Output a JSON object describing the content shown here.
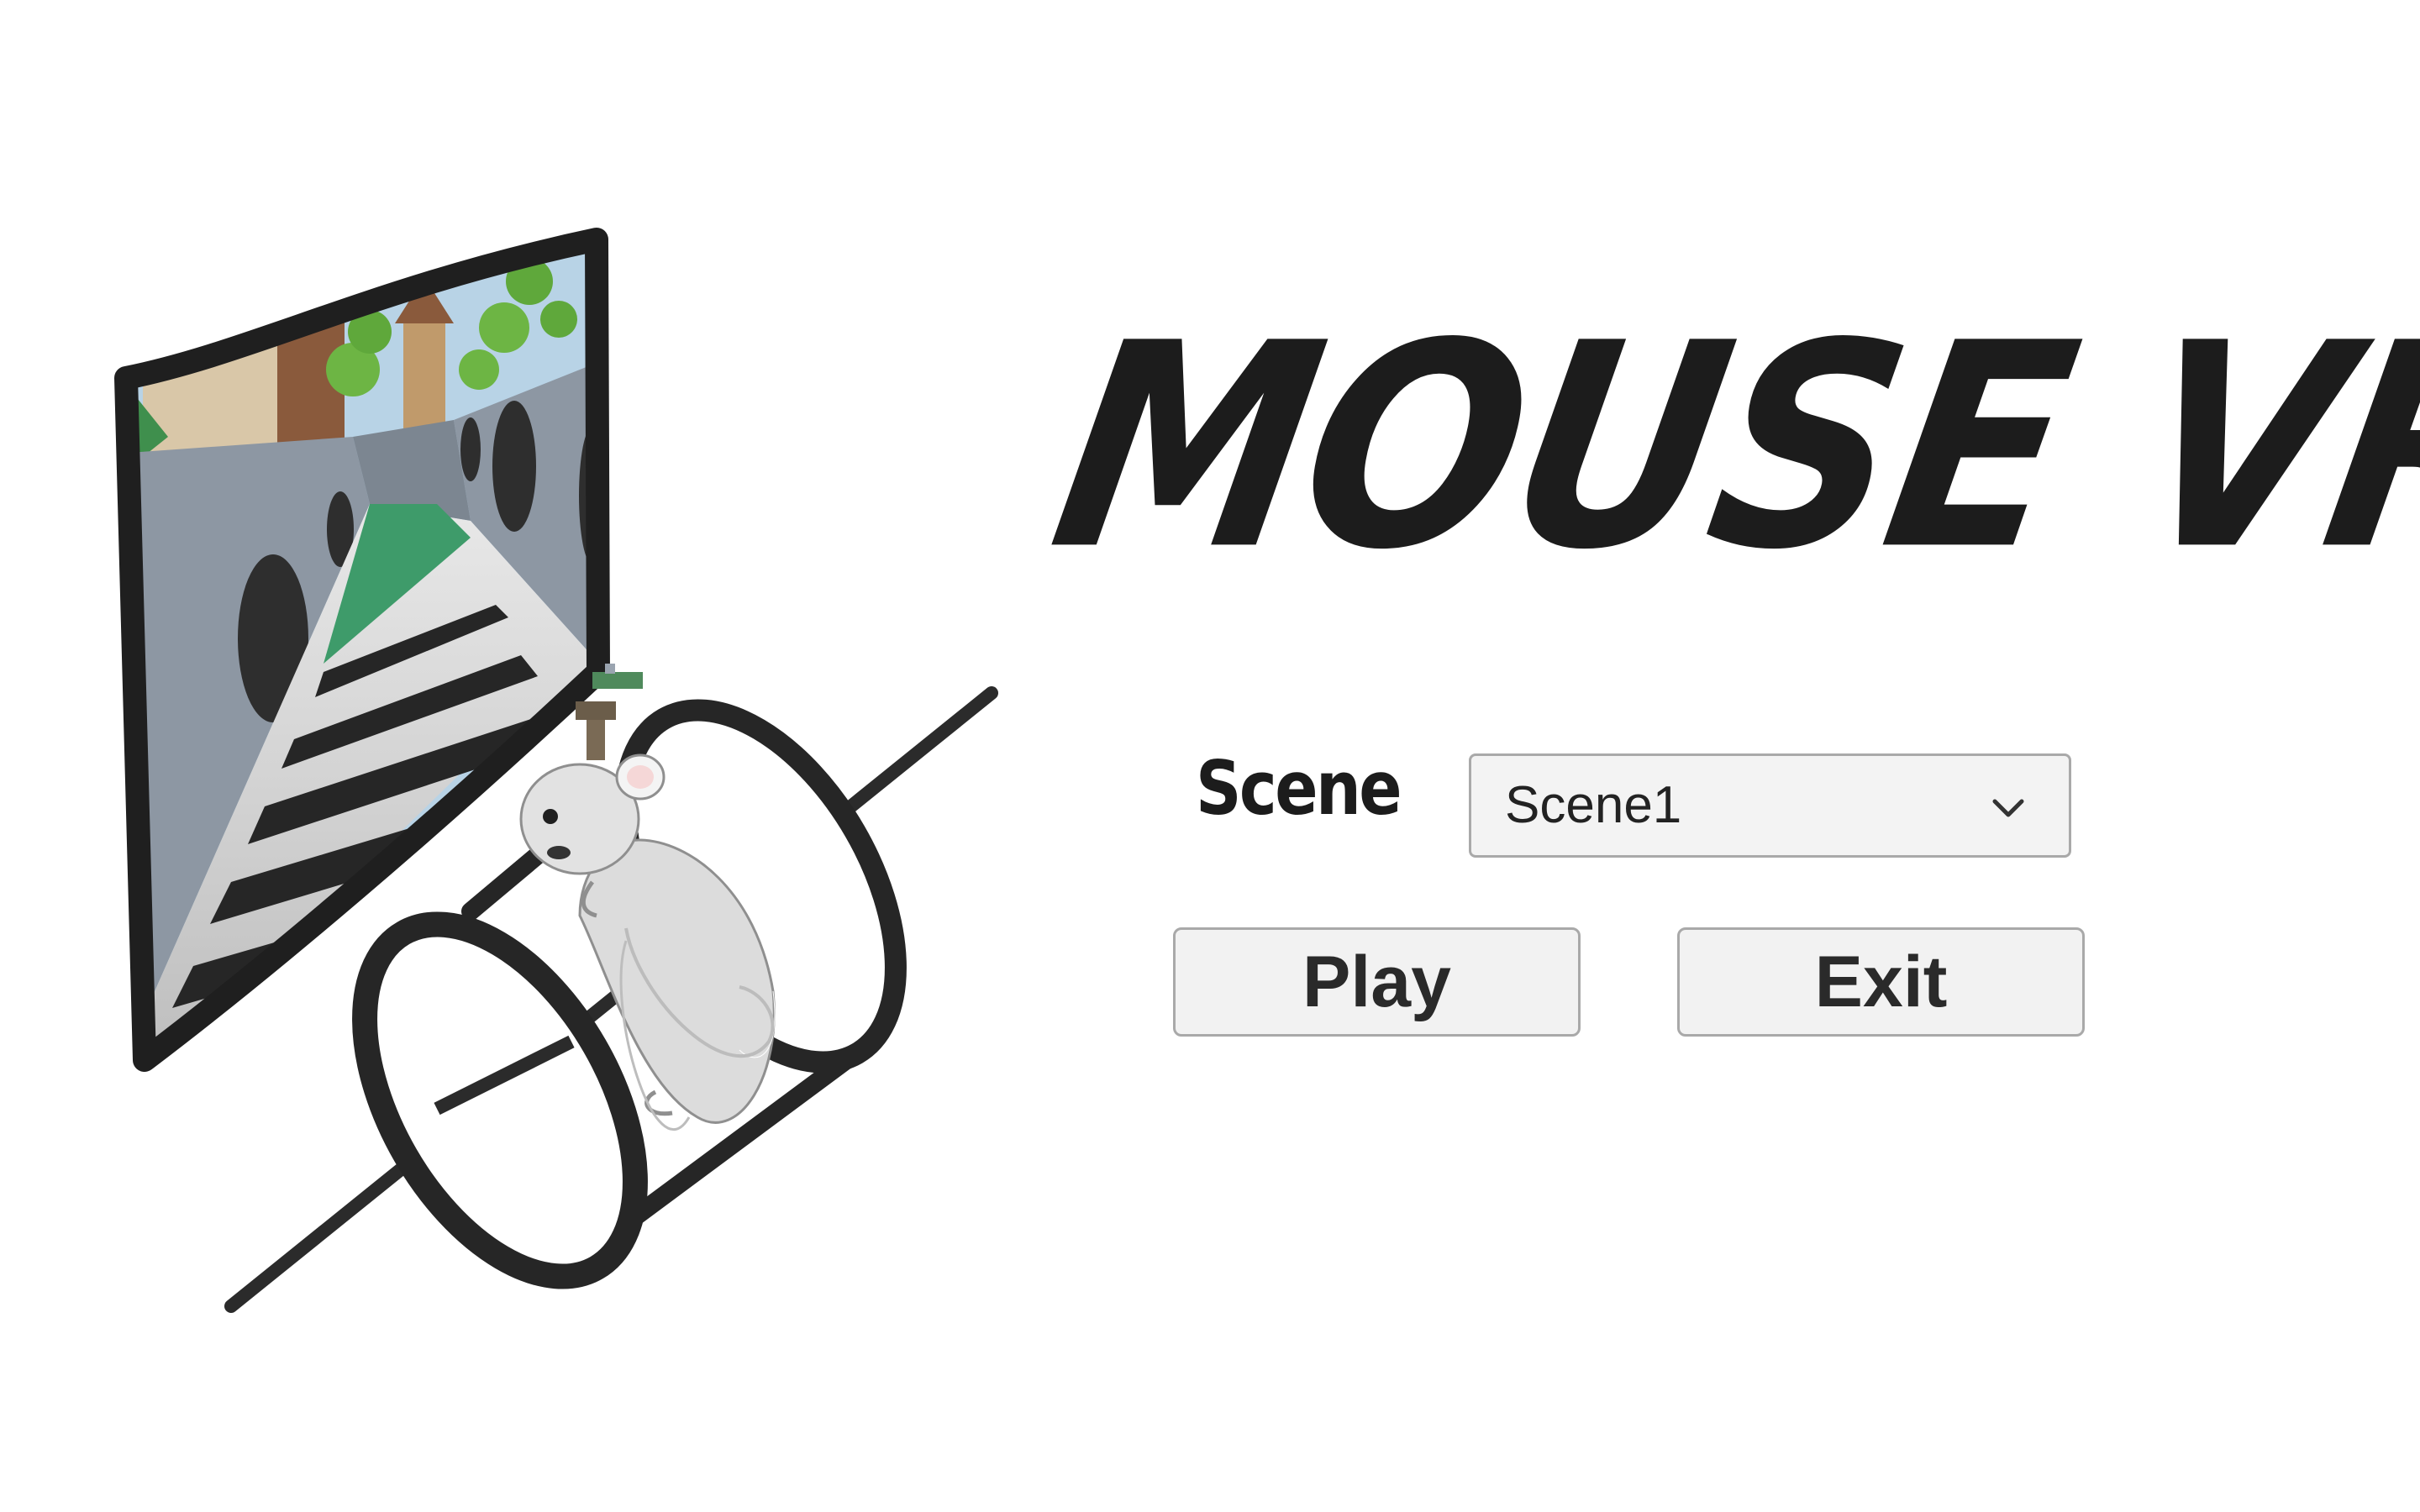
{
  "app": {
    "title": "MOUSE VR"
  },
  "scene_selector": {
    "label": "Scene",
    "selected": "Scene1",
    "dropdown_icon": "chevron-down-icon"
  },
  "actions": {
    "play_label": "Play",
    "exit_label": "Exit"
  },
  "illustration": {
    "subject": "mouse-on-treadmill-with-vr-screen",
    "colors": {
      "outline": "#222222",
      "wall": "#8d97a3",
      "sky": "#b8d3e6",
      "grass": "#3e9b6a",
      "trees": "#6db544"
    }
  },
  "theme": {
    "background": "#ffffff",
    "text": "#1c1c1c",
    "control_fill": "#f2f2f2",
    "control_border": "#a9a9a9"
  }
}
